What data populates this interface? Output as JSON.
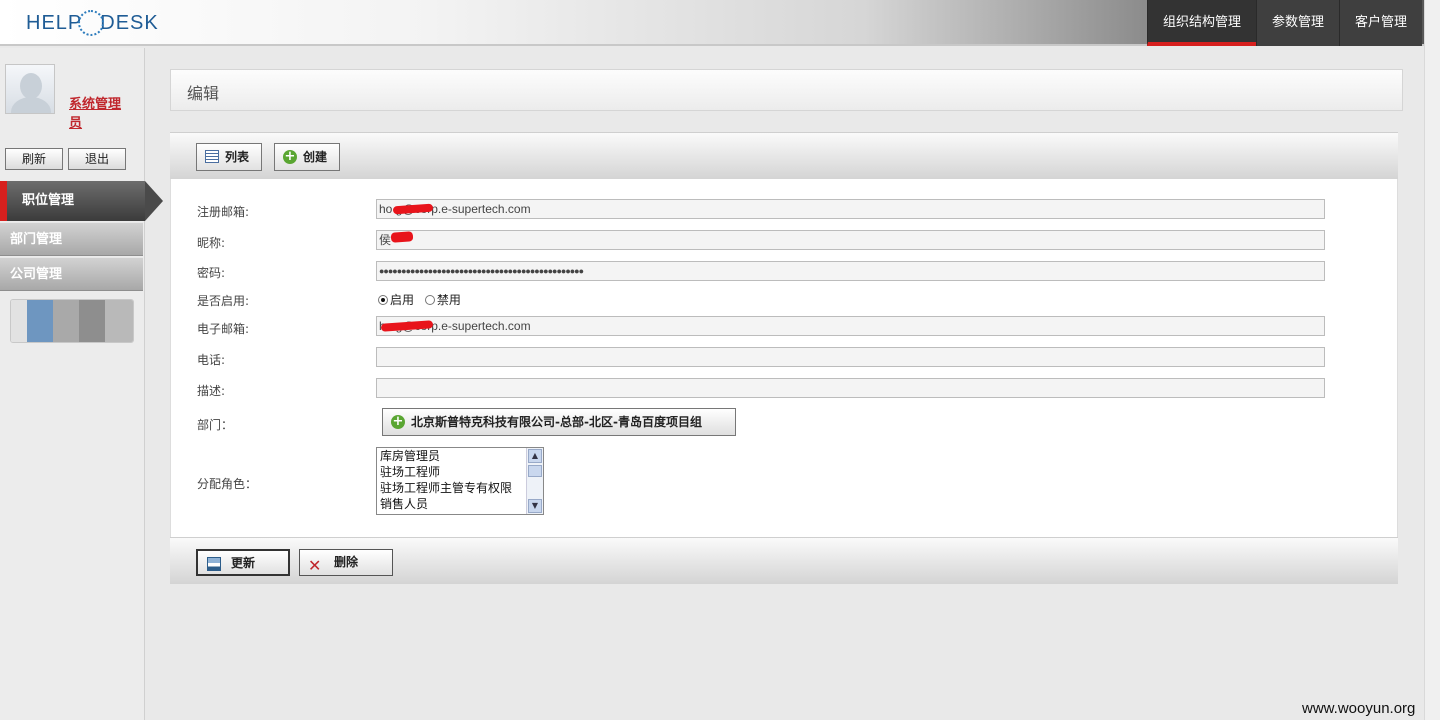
{
  "header": {
    "logo_text_left": "HELP",
    "logo_text_right": "DESK",
    "nav": [
      {
        "label": "组织结构管理",
        "active": true
      },
      {
        "label": "参数管理",
        "active": false
      },
      {
        "label": "客户管理",
        "active": false
      }
    ]
  },
  "sidebar": {
    "username": "系统管理员",
    "refresh_label": "刷新",
    "logout_label": "退出",
    "active_menu": "职位管理",
    "menu_items": [
      "部门管理",
      "公司管理"
    ]
  },
  "page": {
    "title": "编辑",
    "list_button": "列表",
    "create_button": "创建"
  },
  "form": {
    "register_email_label": "注册邮箱:",
    "register_email_value": "ho        g@corp.e-supertech.com",
    "nickname_label": "昵称:",
    "nickname_value": "侯",
    "password_label": "密码:",
    "password_value": "●●●●●●●●●●●●●●●●●●●●●●●●●●●●●●●●●●●●●●●●●●●●●●",
    "enabled_label": "是否启用:",
    "enabled_on": "启用",
    "enabled_off": "禁用",
    "email_label": "电子邮箱:",
    "email_value": "ho        g@corp.e-supertech.com",
    "phone_label": "电话:",
    "phone_value": "",
    "desc_label": "描述:",
    "desc_value": "",
    "dept_label": "部门：",
    "dept_value": "北京斯普特克科技有限公司-总部-北区-青岛百度项目组",
    "roles_label": "分配角色：",
    "roles": [
      "库房管理员",
      "驻场工程师",
      "驻场工程师主管专有权限",
      "销售人员"
    ]
  },
  "footer": {
    "update_button": "更新",
    "delete_button": "删除"
  },
  "watermark": "www.wooyun.org",
  "colors": {
    "accent_red": "#d7201e",
    "username_red": "#c0272d",
    "brand_blue": "#1f5c95"
  }
}
